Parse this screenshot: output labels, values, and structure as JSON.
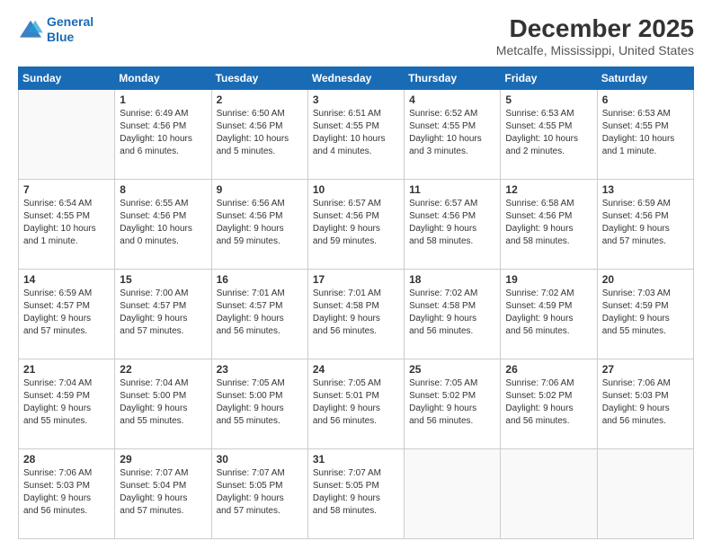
{
  "logo": {
    "line1": "General",
    "line2": "Blue"
  },
  "title": "December 2025",
  "subtitle": "Metcalfe, Mississippi, United States",
  "weekdays": [
    "Sunday",
    "Monday",
    "Tuesday",
    "Wednesday",
    "Thursday",
    "Friday",
    "Saturday"
  ],
  "weeks": [
    [
      {
        "day": "",
        "info": ""
      },
      {
        "day": "1",
        "info": "Sunrise: 6:49 AM\nSunset: 4:56 PM\nDaylight: 10 hours\nand 6 minutes."
      },
      {
        "day": "2",
        "info": "Sunrise: 6:50 AM\nSunset: 4:56 PM\nDaylight: 10 hours\nand 5 minutes."
      },
      {
        "day": "3",
        "info": "Sunrise: 6:51 AM\nSunset: 4:55 PM\nDaylight: 10 hours\nand 4 minutes."
      },
      {
        "day": "4",
        "info": "Sunrise: 6:52 AM\nSunset: 4:55 PM\nDaylight: 10 hours\nand 3 minutes."
      },
      {
        "day": "5",
        "info": "Sunrise: 6:53 AM\nSunset: 4:55 PM\nDaylight: 10 hours\nand 2 minutes."
      },
      {
        "day": "6",
        "info": "Sunrise: 6:53 AM\nSunset: 4:55 PM\nDaylight: 10 hours\nand 1 minute."
      }
    ],
    [
      {
        "day": "7",
        "info": "Sunrise: 6:54 AM\nSunset: 4:55 PM\nDaylight: 10 hours\nand 1 minute."
      },
      {
        "day": "8",
        "info": "Sunrise: 6:55 AM\nSunset: 4:56 PM\nDaylight: 10 hours\nand 0 minutes."
      },
      {
        "day": "9",
        "info": "Sunrise: 6:56 AM\nSunset: 4:56 PM\nDaylight: 9 hours\nand 59 minutes."
      },
      {
        "day": "10",
        "info": "Sunrise: 6:57 AM\nSunset: 4:56 PM\nDaylight: 9 hours\nand 59 minutes."
      },
      {
        "day": "11",
        "info": "Sunrise: 6:57 AM\nSunset: 4:56 PM\nDaylight: 9 hours\nand 58 minutes."
      },
      {
        "day": "12",
        "info": "Sunrise: 6:58 AM\nSunset: 4:56 PM\nDaylight: 9 hours\nand 58 minutes."
      },
      {
        "day": "13",
        "info": "Sunrise: 6:59 AM\nSunset: 4:56 PM\nDaylight: 9 hours\nand 57 minutes."
      }
    ],
    [
      {
        "day": "14",
        "info": "Sunrise: 6:59 AM\nSunset: 4:57 PM\nDaylight: 9 hours\nand 57 minutes."
      },
      {
        "day": "15",
        "info": "Sunrise: 7:00 AM\nSunset: 4:57 PM\nDaylight: 9 hours\nand 57 minutes."
      },
      {
        "day": "16",
        "info": "Sunrise: 7:01 AM\nSunset: 4:57 PM\nDaylight: 9 hours\nand 56 minutes."
      },
      {
        "day": "17",
        "info": "Sunrise: 7:01 AM\nSunset: 4:58 PM\nDaylight: 9 hours\nand 56 minutes."
      },
      {
        "day": "18",
        "info": "Sunrise: 7:02 AM\nSunset: 4:58 PM\nDaylight: 9 hours\nand 56 minutes."
      },
      {
        "day": "19",
        "info": "Sunrise: 7:02 AM\nSunset: 4:59 PM\nDaylight: 9 hours\nand 56 minutes."
      },
      {
        "day": "20",
        "info": "Sunrise: 7:03 AM\nSunset: 4:59 PM\nDaylight: 9 hours\nand 55 minutes."
      }
    ],
    [
      {
        "day": "21",
        "info": "Sunrise: 7:04 AM\nSunset: 4:59 PM\nDaylight: 9 hours\nand 55 minutes."
      },
      {
        "day": "22",
        "info": "Sunrise: 7:04 AM\nSunset: 5:00 PM\nDaylight: 9 hours\nand 55 minutes."
      },
      {
        "day": "23",
        "info": "Sunrise: 7:05 AM\nSunset: 5:00 PM\nDaylight: 9 hours\nand 55 minutes."
      },
      {
        "day": "24",
        "info": "Sunrise: 7:05 AM\nSunset: 5:01 PM\nDaylight: 9 hours\nand 56 minutes."
      },
      {
        "day": "25",
        "info": "Sunrise: 7:05 AM\nSunset: 5:02 PM\nDaylight: 9 hours\nand 56 minutes."
      },
      {
        "day": "26",
        "info": "Sunrise: 7:06 AM\nSunset: 5:02 PM\nDaylight: 9 hours\nand 56 minutes."
      },
      {
        "day": "27",
        "info": "Sunrise: 7:06 AM\nSunset: 5:03 PM\nDaylight: 9 hours\nand 56 minutes."
      }
    ],
    [
      {
        "day": "28",
        "info": "Sunrise: 7:06 AM\nSunset: 5:03 PM\nDaylight: 9 hours\nand 56 minutes."
      },
      {
        "day": "29",
        "info": "Sunrise: 7:07 AM\nSunset: 5:04 PM\nDaylight: 9 hours\nand 57 minutes."
      },
      {
        "day": "30",
        "info": "Sunrise: 7:07 AM\nSunset: 5:05 PM\nDaylight: 9 hours\nand 57 minutes."
      },
      {
        "day": "31",
        "info": "Sunrise: 7:07 AM\nSunset: 5:05 PM\nDaylight: 9 hours\nand 58 minutes."
      },
      {
        "day": "",
        "info": ""
      },
      {
        "day": "",
        "info": ""
      },
      {
        "day": "",
        "info": ""
      }
    ]
  ]
}
